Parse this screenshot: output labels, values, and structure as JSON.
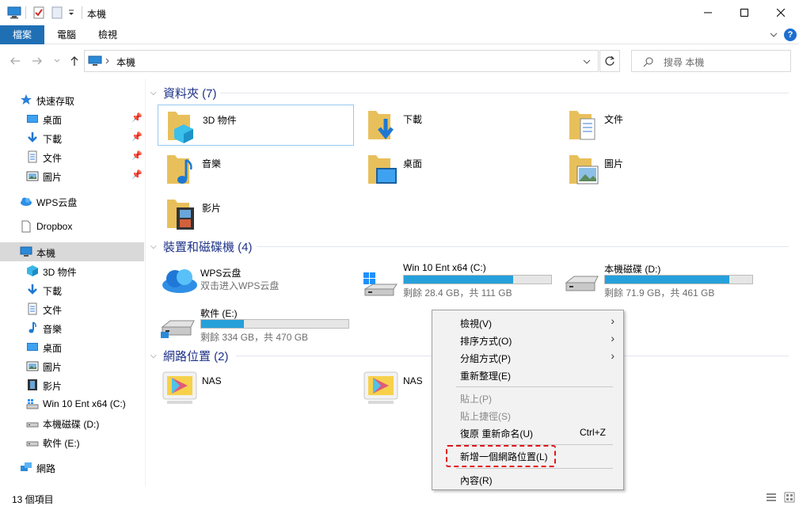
{
  "window": {
    "title": "本機"
  },
  "ribbon": {
    "tabs": [
      "檔案",
      "電腦",
      "檢視"
    ]
  },
  "address": {
    "path": "本機",
    "search_placeholder": "搜尋 本機"
  },
  "sidebar": {
    "quick_access": "快速存取",
    "quick_items": [
      "桌面",
      "下載",
      "文件",
      "圖片"
    ],
    "wps": "WPS云盘",
    "dropbox": "Dropbox",
    "this_pc": "本機",
    "pc_items": [
      "3D 物件",
      "下載",
      "文件",
      "音樂",
      "桌面",
      "圖片",
      "影片",
      "Win 10 Ent x64 (C:)",
      "本機磁碟 (D:)",
      "軟件 (E:)"
    ],
    "network": "網路"
  },
  "content": {
    "folders_header": "資料夾 (7)",
    "folders": [
      "3D 物件",
      "下載",
      "文件",
      "音樂",
      "桌面",
      "圖片",
      "影片"
    ],
    "devices_header": "裝置和磁碟機 (4)",
    "wps_drive": {
      "name": "WPS云盘",
      "sub": "双击进入WPS云盘"
    },
    "drives": [
      {
        "name": "Win 10 Ent x64 (C:)",
        "sub": "剩餘 28.4 GB，共 111 GB",
        "used": 0.744
      },
      {
        "name": "本機磁碟 (D:)",
        "sub": "剩餘 71.9 GB，共 461 GB",
        "used": 0.844
      },
      {
        "name": "軟件 (E:)",
        "sub": "剩餘 334 GB，共 470 GB",
        "used": 0.289
      }
    ],
    "network_header": "網路位置 (2)",
    "network_items": [
      "NAS",
      "NAS"
    ]
  },
  "context_menu": {
    "view": "檢視(V)",
    "sort": "排序方式(O)",
    "group": "分組方式(P)",
    "refresh": "重新整理(E)",
    "paste": "貼上(P)",
    "paste_shortcut": "貼上捷徑(S)",
    "undo": "復原 重新命名(U)",
    "undo_shortcut": "Ctrl+Z",
    "add_network": "新增一個網路位置(L)",
    "properties": "內容(R)"
  },
  "status": {
    "count": "13 個項目"
  },
  "colors": {
    "accent": "#1f6fb5",
    "drive_bar": "#26a0da",
    "header_text": "#1e3287",
    "highlight": "#e3141b"
  }
}
